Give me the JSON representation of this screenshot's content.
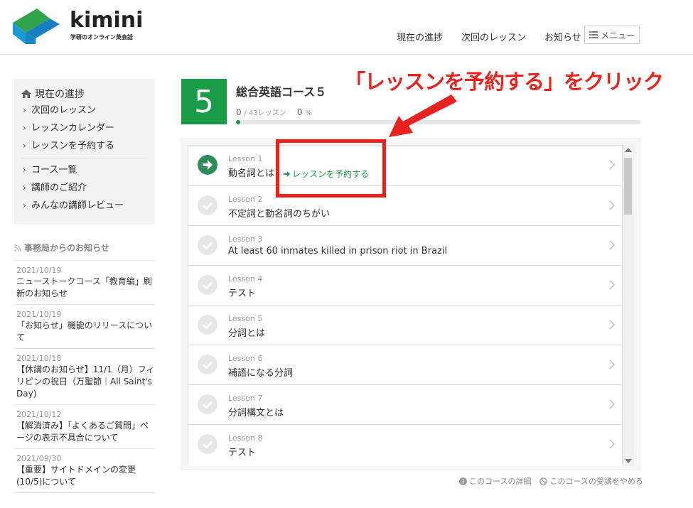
{
  "brand": {
    "name": "kimini",
    "subtitle": "学研のオンライン英会話"
  },
  "topnav": {
    "items": [
      "現在の進捗",
      "次回のレッスン",
      "お知らせ"
    ],
    "menu_label": "メニュー"
  },
  "sidebar": {
    "home_label": "現在の進捗",
    "items": [
      "次回のレッスン",
      "レッスンカレンダー",
      "レッスンを予約する",
      "コース一覧",
      "講師のご紹介",
      "みんなの講師レビュー"
    ]
  },
  "news": {
    "heading": "事務局からのお知らせ",
    "items": [
      {
        "date": "2021/10/19",
        "title": "ニューストークコース「教育編」刷新のお知らせ"
      },
      {
        "date": "2021/10/19",
        "title": "「お知らせ」機能のリリースについて"
      },
      {
        "date": "2021/10/18",
        "title": "【休講のお知らせ】11/1（月）フィリピンの祝日（万聖節｜All Saint's Day)"
      },
      {
        "date": "2021/10/12",
        "title": "【解消済み】「よくあるご質問」ページの表示不具合について"
      },
      {
        "date": "2021/09/30",
        "title": "【重要】サイトドメインの変更(10/5)について"
      }
    ]
  },
  "course": {
    "number": "5",
    "title": "総合英語コース５",
    "done": "0",
    "total_label": "/ 43レッスン",
    "percent": "0",
    "percent_unit": "%",
    "progress_fraction": 0.0
  },
  "annotation": {
    "text": "「レッスンを予約する」をクリック",
    "color": "#e8231f"
  },
  "lessons": [
    {
      "num": "Lesson 1",
      "title": "動名詞とは",
      "reserve": "レッスンを予約する",
      "state": "current"
    },
    {
      "num": "Lesson 2",
      "title": "不定詞と動名詞のちがい",
      "state": "todo"
    },
    {
      "num": "Lesson 3",
      "title": "At least 60 inmates killed in prison riot in Brazil",
      "state": "todo"
    },
    {
      "num": "Lesson 4",
      "title": "テスト",
      "state": "todo"
    },
    {
      "num": "Lesson 5",
      "title": "分詞とは",
      "state": "todo"
    },
    {
      "num": "Lesson 6",
      "title": "補語になる分詞",
      "state": "todo"
    },
    {
      "num": "Lesson 7",
      "title": "分詞構文とは",
      "state": "todo"
    },
    {
      "num": "Lesson 8",
      "title": "テスト",
      "state": "todo"
    }
  ],
  "footer": {
    "detail": "このコースの詳細",
    "quit": "このコースの受講をやめる"
  },
  "colors": {
    "accent": "#1b9a48",
    "annotation": "#e8231f"
  }
}
